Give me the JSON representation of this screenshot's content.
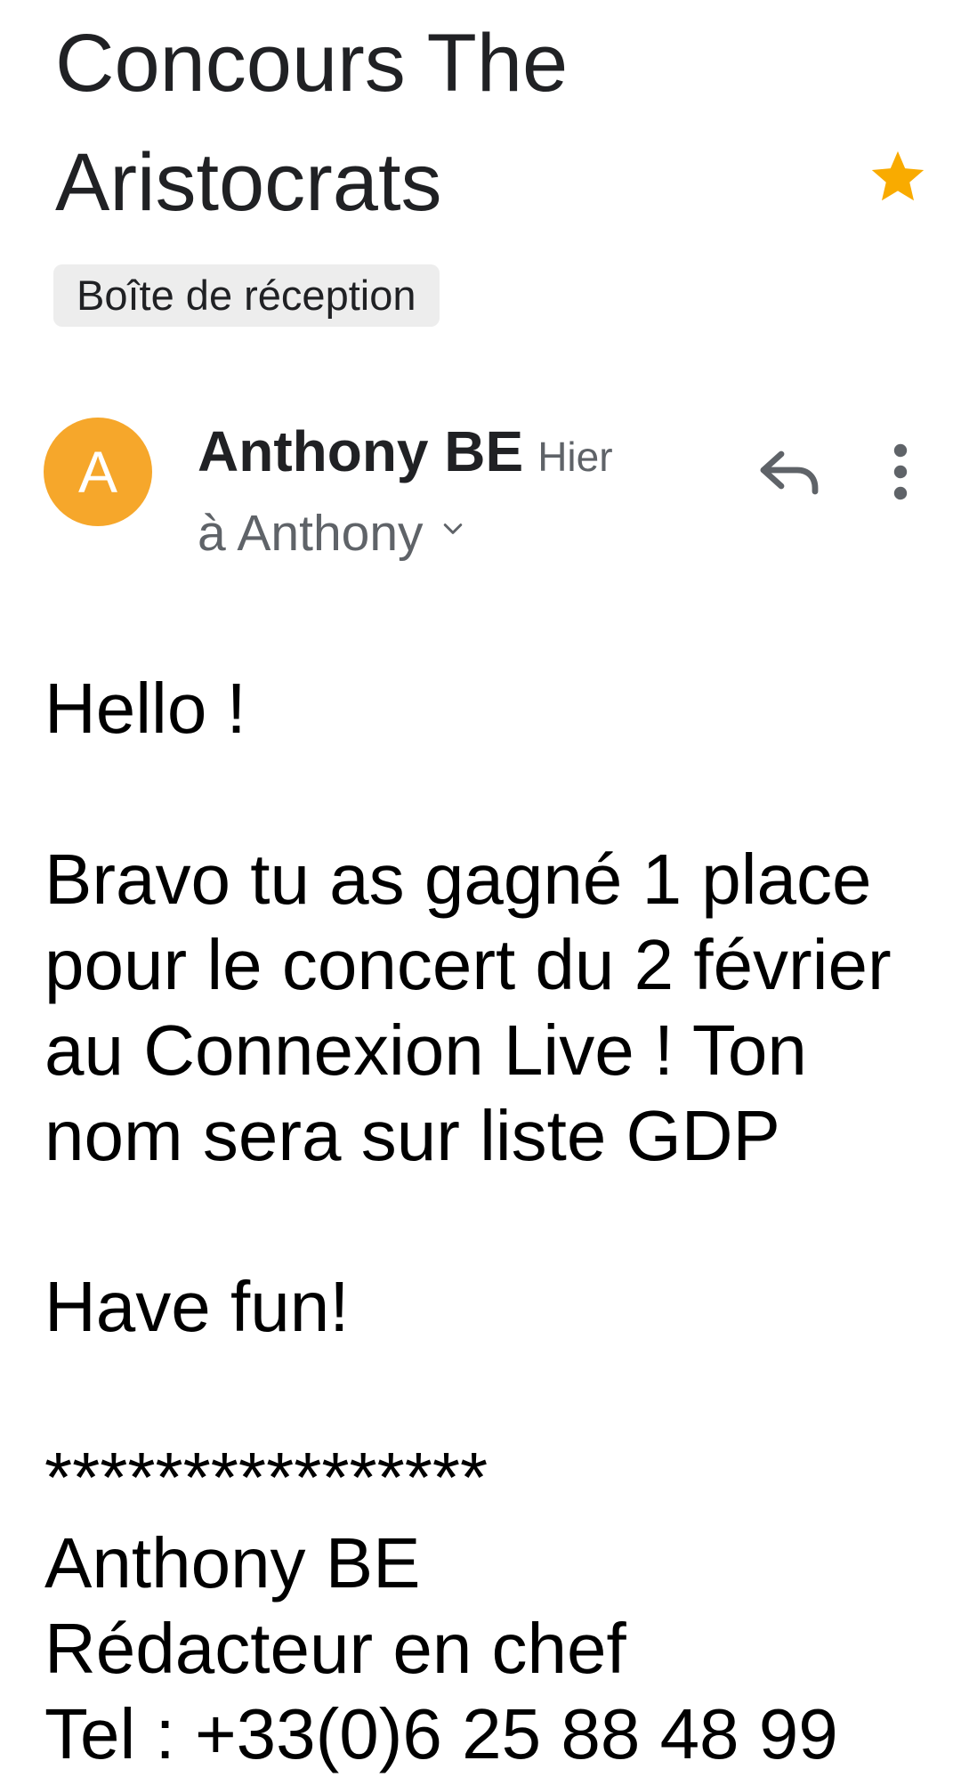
{
  "email": {
    "subject": "Concours The Aristocrats",
    "label": "Boîte de réception",
    "starred": true,
    "star_color": "#f9ab00",
    "sender": {
      "initial": "A",
      "name": "Anthony BE",
      "time": "Hier",
      "recipient": "à Anthony",
      "avatar_color": "#f6a72b"
    },
    "actions": {
      "reply_icon": "reply-icon",
      "more_icon": "more-vert-icon"
    },
    "body": {
      "greeting": "Hello !",
      "paragraph": "Bravo tu as gagné 1 place pour le concert du 2 février au Connexion Live ! Ton nom sera sur liste GDP",
      "closing": "Have fun!",
      "separator": "****************",
      "signature_name": "Anthony BE",
      "signature_title": "Rédacteur en chef",
      "signature_phone": "Tel : +33(0)6 25 88 48 99"
    }
  }
}
